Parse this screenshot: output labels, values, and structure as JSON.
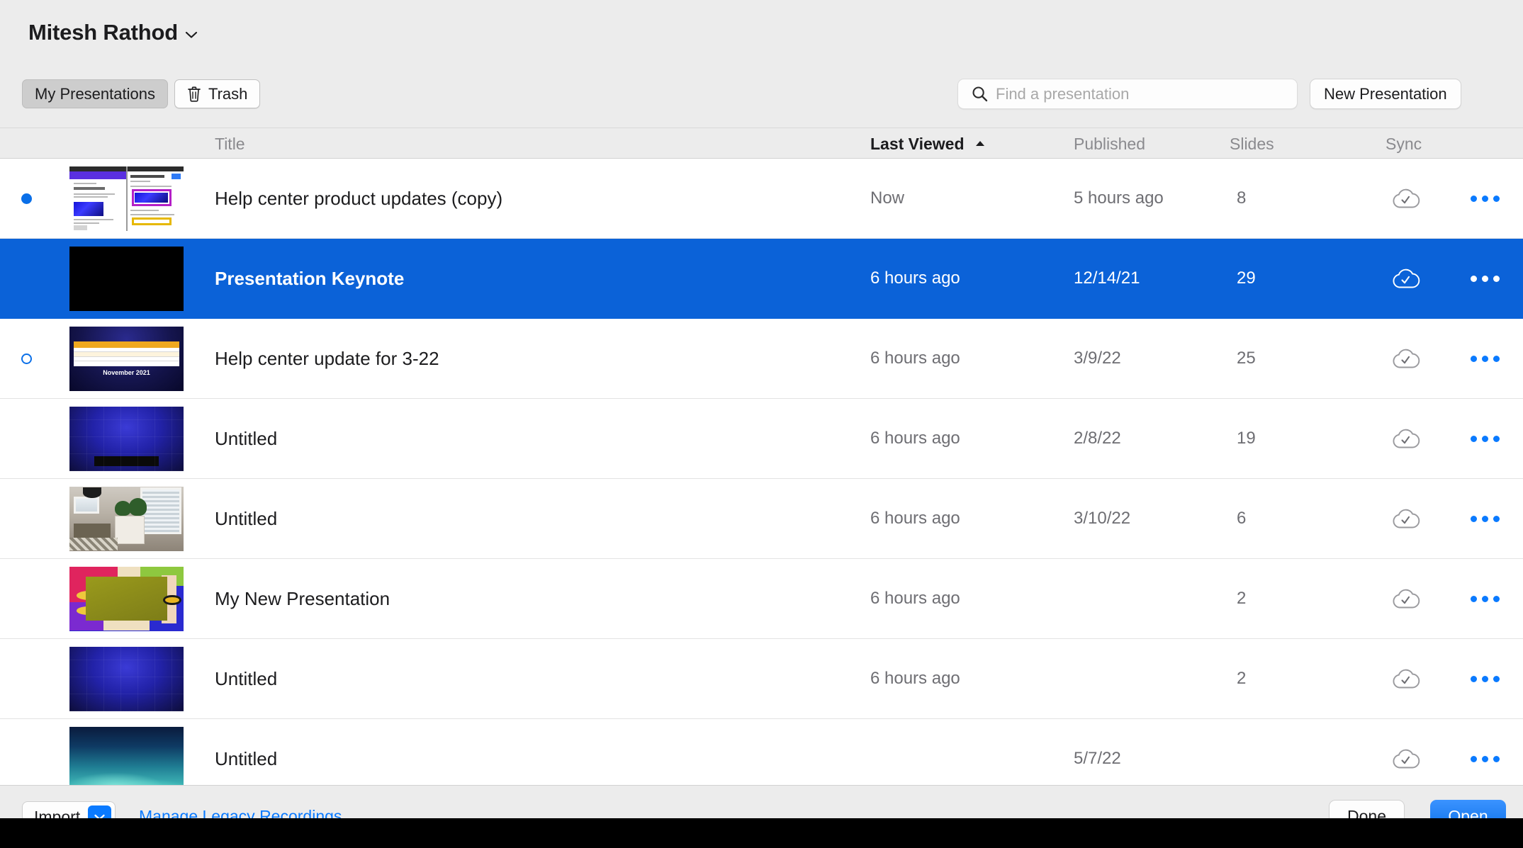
{
  "header": {
    "account_name": "Mitesh Rathod",
    "account_chevron_icon": "chevron-down-icon",
    "tabs": [
      {
        "label": "My Presentations",
        "active": true,
        "icon": null
      },
      {
        "label": "Trash",
        "active": false,
        "icon": "trash-icon"
      }
    ],
    "search": {
      "placeholder": "Find a presentation",
      "value": "",
      "icon": "search-icon"
    },
    "new_presentation_label": "New Presentation"
  },
  "columns": {
    "title": "Title",
    "last_viewed": "Last Viewed",
    "published": "Published",
    "slides": "Slides",
    "sync": "Sync",
    "sort_by": "Last Viewed",
    "sort_direction": "ascending",
    "sort_caret_icon": "caret-up-icon"
  },
  "rows": [
    {
      "status_dot": "filled",
      "thumbnail": "doc-split",
      "title": "Help center product updates (copy)",
      "last_viewed": "Now",
      "published": "5 hours ago",
      "slides": "8",
      "sync_icon": "cloud-check-icon",
      "more_icon": "ellipsis-icon",
      "selected": false
    },
    {
      "status_dot": "none",
      "thumbnail": "black",
      "title": "Presentation Keynote",
      "last_viewed": "6 hours ago",
      "published": "12/14/21",
      "slides": "29",
      "sync_icon": "cloud-check-icon",
      "more_icon": "ellipsis-icon",
      "selected": true
    },
    {
      "status_dot": "hollow",
      "thumbnail": "november",
      "title": "Help center update for 3-22",
      "last_viewed": "6 hours ago",
      "published": "3/9/22",
      "slides": "25",
      "sync_icon": "cloud-check-icon",
      "more_icon": "ellipsis-icon",
      "selected": false
    },
    {
      "status_dot": "none",
      "thumbnail": "blue-grid",
      "title": "Untitled",
      "last_viewed": "6 hours ago",
      "published": "2/8/22",
      "slides": "19",
      "sync_icon": "cloud-check-icon",
      "more_icon": "ellipsis-icon",
      "selected": false
    },
    {
      "status_dot": "none",
      "thumbnail": "room",
      "title": "Untitled",
      "last_viewed": "6 hours ago",
      "published": "3/10/22",
      "slides": "6",
      "sync_icon": "cloud-check-icon",
      "more_icon": "ellipsis-icon",
      "selected": false
    },
    {
      "status_dot": "none",
      "thumbnail": "art",
      "title": "My New Presentation",
      "last_viewed": "6 hours ago",
      "published": "",
      "slides": "2",
      "sync_icon": "cloud-check-icon",
      "more_icon": "ellipsis-icon",
      "selected": false
    },
    {
      "status_dot": "none",
      "thumbnail": "blue-grid",
      "title": "Untitled",
      "last_viewed": "6 hours ago",
      "published": "",
      "slides": "2",
      "sync_icon": "cloud-check-icon",
      "more_icon": "ellipsis-icon",
      "selected": false
    },
    {
      "status_dot": "none",
      "thumbnail": "teal",
      "title": "Untitled",
      "last_viewed": "",
      "published": "5/7/22",
      "slides": "",
      "sync_icon": "cloud-check-icon",
      "more_icon": "ellipsis-icon",
      "selected": false
    }
  ],
  "footer": {
    "import_label": "Import",
    "import_chevron_icon": "chevron-down-icon",
    "legacy_link": "Manage Legacy Recordings...",
    "done_label": "Done",
    "open_label": "Open"
  },
  "colors": {
    "selection_blue": "#0b62d8",
    "accent_blue": "#0a7aff",
    "window_chrome": "#ececec",
    "list_background": "#ffffff",
    "secondary_text": "#6e6e73"
  }
}
